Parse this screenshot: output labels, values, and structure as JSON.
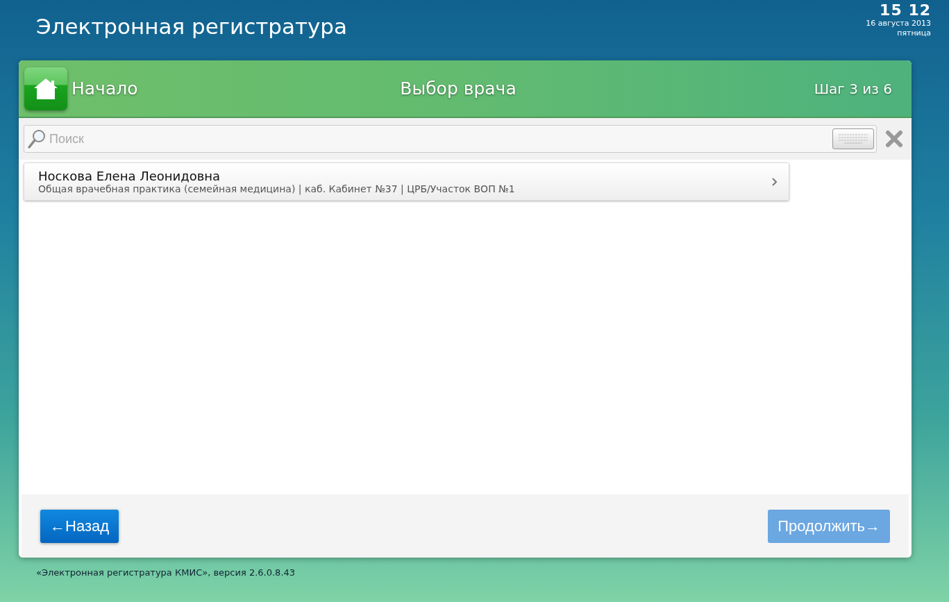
{
  "app_title": "Электронная регистратура",
  "clock": {
    "time": "15 12",
    "date": "16 августа 2013",
    "weekday": "пятница"
  },
  "panel_header": {
    "home_label": "Начало",
    "title": "Выбор врача",
    "step": "Шаг 3 из 6"
  },
  "search": {
    "placeholder": "Поиск"
  },
  "doctors": [
    {
      "name": "Носкова Елена Леонидовна",
      "details": "Общая врачебная практика (семейная медицина) | каб. Кабинет №37 | ЦРБ/Участок ВОП №1"
    }
  ],
  "buttons": [
    {
      "kind": "back",
      "label": "←Назад",
      "disabled": false
    },
    {
      "kind": "next",
      "label": "Продолжить→",
      "disabled": true
    }
  ],
  "footer": "«Электронная регистратура КМИС», версия 2.6.0.8.43"
}
